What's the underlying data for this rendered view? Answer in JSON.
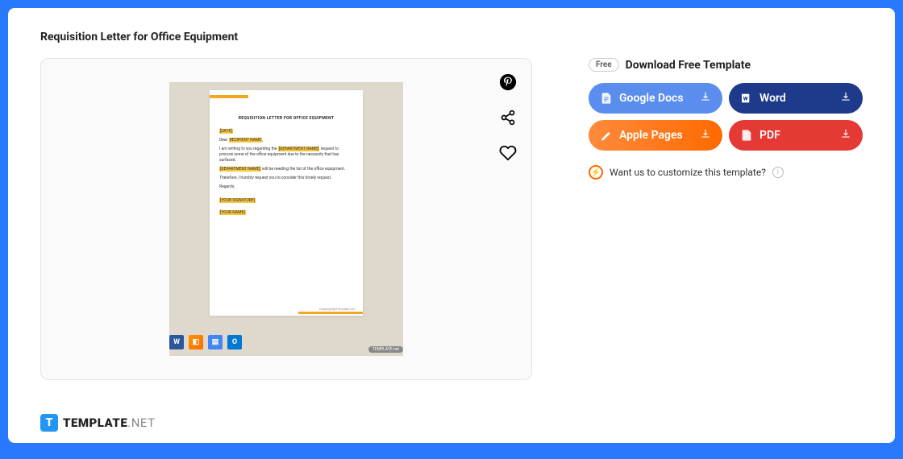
{
  "title": "Requisition Letter for Office Equipment",
  "downloadHeader": {
    "free": "Free",
    "label": "Download Free Template"
  },
  "buttons": {
    "docs": "Google Docs",
    "word": "Word",
    "pages": "Apple Pages",
    "pdf": "PDF"
  },
  "customize": "Want us to customize this template?",
  "logo": {
    "main": "TEMPLATE",
    "suffix": ".NET",
    "icon": "T"
  },
  "doc": {
    "heading": "REQUISITION LETTER FOR OFFICE EQUIPMENT",
    "date": "[DATE]",
    "dear": "Dear",
    "recipient": "RECIPIENT NAME",
    "body1_a": "I am writing to you regarding the",
    "dept": "[DEPARTMENT NAME]",
    "body1_b": "request to procure some of the office equipment due to the necessity that has surfaced.",
    "body2_a": "[DEPARTMENT NAME]",
    "body2_b": "will be needing the list of the office equipment.",
    "body3": "Therefore, I humbly request you to consider this timely request.",
    "regards": "Regards,",
    "sig": "[YOUR SIGNATURE]",
    "name": "[YOUR NAME]",
    "copyright": "Copyright@Template.net"
  },
  "badge": "TEMPLATE.net"
}
